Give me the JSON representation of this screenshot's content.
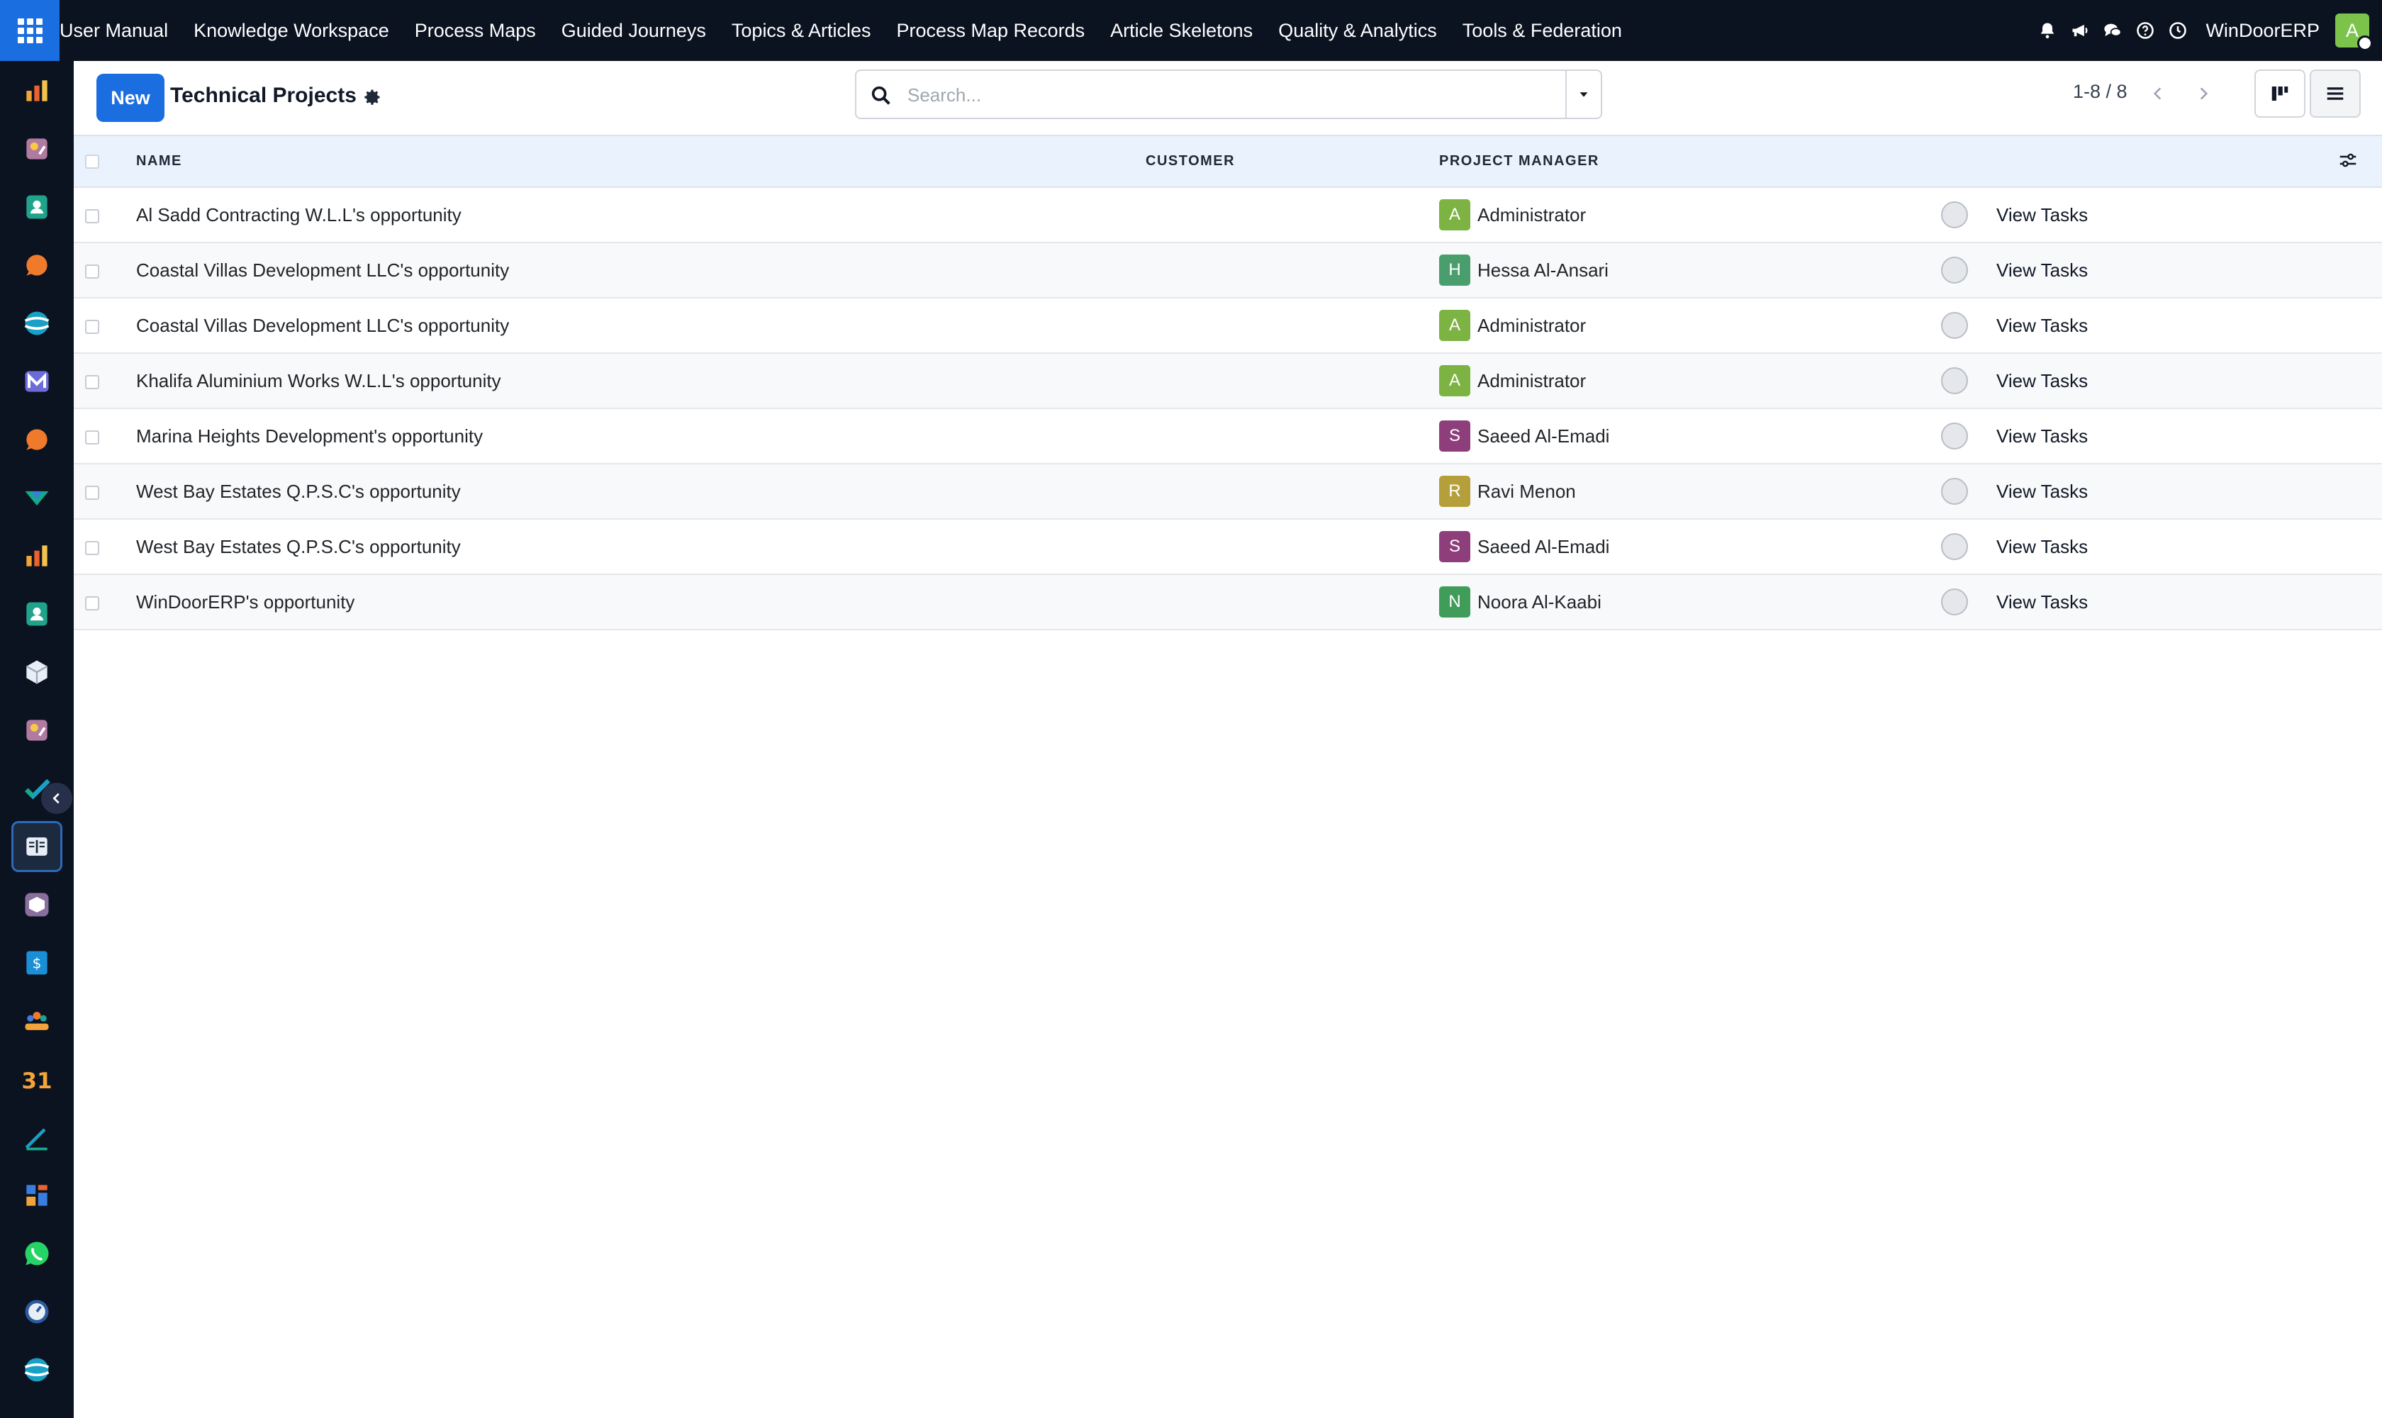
{
  "navbar": {
    "menu": [
      "User Manual",
      "Knowledge Workspace",
      "Process Maps",
      "Guided Journeys",
      "Topics & Articles",
      "Process Map Records",
      "Article Skeletons",
      "Quality & Analytics",
      "Tools & Federation"
    ],
    "company": "WinDoorERP",
    "user_initial": "A",
    "user_color": "#7cc34b",
    "tray_icons": [
      "bell-icon",
      "megaphone-icon",
      "chat-icon",
      "help-icon",
      "clock-icon"
    ]
  },
  "sidebar": {
    "apps": [
      "crm-icon",
      "sales-icon",
      "contacts-icon",
      "discuss-icon",
      "website-icon",
      "mail-icon",
      "livechat-icon",
      "project-icon",
      "reporting-icon",
      "employees-icon",
      "inventory-icon",
      "studio-icon",
      "tasks-icon",
      "knowledge-icon",
      "packages-icon",
      "invoicing-icon",
      "team-icon",
      "calendar-icon",
      "sign-icon",
      "dashboard-icon",
      "whatsapp-icon",
      "timer-icon",
      "odoo-icon"
    ],
    "active_app": "knowledge-icon",
    "calendar_label": "31"
  },
  "control_panel": {
    "new_label": "New",
    "title": "Technical Projects",
    "search_placeholder": "Search...",
    "pager_value": "1-8",
    "pager_sep": " / ",
    "pager_total": "8"
  },
  "table": {
    "columns": {
      "name": "NAME",
      "customer": "CUSTOMER",
      "project_manager": "PROJECT MANAGER"
    },
    "rows": [
      {
        "name": "Al Sadd Contracting W.L.L's opportunity",
        "customer": "",
        "pm_initial": "A",
        "pm_name": "Administrator",
        "pm_color": "#7cb342",
        "action": "View Tasks"
      },
      {
        "name": "Coastal Villas Development LLC's opportunity",
        "customer": "",
        "pm_initial": "H",
        "pm_name": "Hessa Al-Ansari",
        "pm_color": "#4a9e6d",
        "action": "View Tasks"
      },
      {
        "name": "Coastal Villas Development LLC's opportunity",
        "customer": "",
        "pm_initial": "A",
        "pm_name": "Administrator",
        "pm_color": "#7cb342",
        "action": "View Tasks"
      },
      {
        "name": "Khalifa Aluminium Works W.L.L's opportunity",
        "customer": "",
        "pm_initial": "A",
        "pm_name": "Administrator",
        "pm_color": "#7cb342",
        "action": "View Tasks"
      },
      {
        "name": "Marina Heights Development's opportunity",
        "customer": "",
        "pm_initial": "S",
        "pm_name": "Saeed Al-Emadi",
        "pm_color": "#8e3e7a",
        "action": "View Tasks"
      },
      {
        "name": "West Bay Estates Q.P.S.C's opportunity",
        "customer": "",
        "pm_initial": "R",
        "pm_name": "Ravi Menon",
        "pm_color": "#b59f3b",
        "action": "View Tasks"
      },
      {
        "name": "West Bay Estates Q.P.S.C's opportunity",
        "customer": "",
        "pm_initial": "S",
        "pm_name": "Saeed Al-Emadi",
        "pm_color": "#8e3e7a",
        "action": "View Tasks"
      },
      {
        "name": "WinDoorERP's opportunity",
        "customer": "",
        "pm_initial": "N",
        "pm_name": "Noora Al-Kaabi",
        "pm_color": "#3f9d59",
        "action": "View Tasks"
      }
    ]
  },
  "colors": {
    "navbar_bg": "#0b1220",
    "primary": "#1b6ee0",
    "header_row_bg": "#e9f2fd"
  }
}
